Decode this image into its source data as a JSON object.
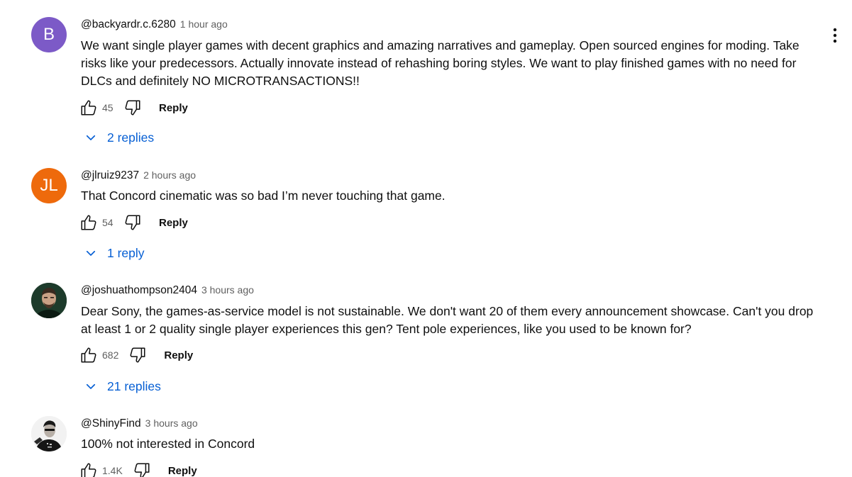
{
  "colors": {
    "link_blue": "#065fd4",
    "avatar_b": "#7c5ac7",
    "avatar_jl": "#ee6a0c",
    "text_primary": "#0f0f0f",
    "text_secondary": "#606060"
  },
  "icons": {
    "like": "thumb-up-outline",
    "dislike": "thumb-down-outline",
    "more": "vertical-ellipsis",
    "expand": "chevron-down"
  },
  "comments": [
    {
      "avatar_text": "B",
      "author": "@backyardr.c.6280",
      "time": "1 hour ago",
      "lines": [
        "We want single player games with decent graphics and amazing narratives and gameplay. Open sourced engines for moding. Take",
        "risks like your predecessors. Actually innovate instead of rehashing boring styles. We want to play finished games with no need for",
        "DLCs and definitely NO MICROTRANSACTIONS!!"
      ],
      "likes": "45",
      "reply_label": "Reply",
      "replies_label": "2 replies"
    },
    {
      "avatar_text": "JL",
      "author": "@jlruiz9237",
      "time": "2 hours ago",
      "lines": [
        "That Concord cinematic was so bad I’m never touching that game."
      ],
      "likes": "54",
      "reply_label": "Reply",
      "replies_label": "1 reply"
    },
    {
      "avatar_text": "",
      "author": "@joshuathompson2404",
      "time": "3 hours ago",
      "lines": [
        "Dear Sony, the games-as-service model is not sustainable. We don't want 20 of them every announcement showcase. Can't you drop",
        "at least 1 or 2 quality single player experiences this gen? Tent pole experiences, like you used to be known for?"
      ],
      "likes": "682",
      "reply_label": "Reply",
      "replies_label": "21 replies"
    },
    {
      "avatar_text": "",
      "author": "@ShinyFind",
      "time": "3 hours ago",
      "lines": [
        "100% not interested in Concord"
      ],
      "likes": "1.4K",
      "reply_label": "Reply"
    }
  ]
}
